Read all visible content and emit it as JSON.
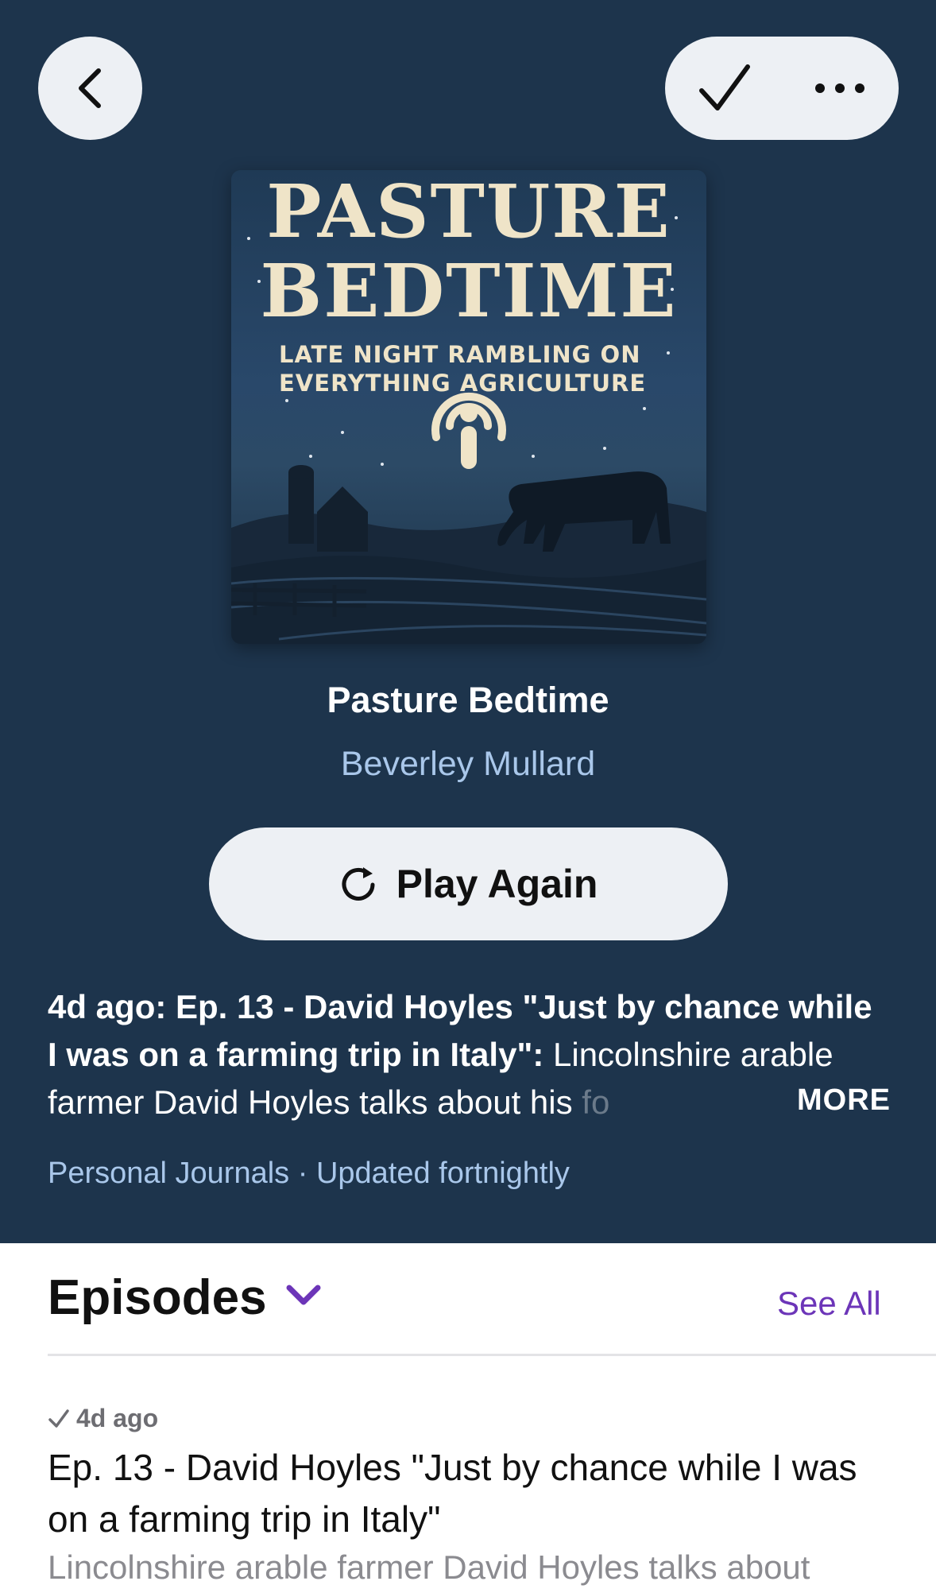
{
  "nav": {
    "back_icon": "chevron-left-icon",
    "check_icon": "checkmark-icon",
    "more_icon": "ellipsis-icon"
  },
  "cover": {
    "title_line1": "PASTURE",
    "title_line2": "BEDTIME",
    "subtitle_line1": "LATE NIGHT RAMBLING ON",
    "subtitle_line2": "EVERYTHING AGRICULTURE",
    "icon": "podcast-icon"
  },
  "show": {
    "title": "Pasture Bedtime",
    "author": "Beverley Mullard"
  },
  "play": {
    "label": "Play Again",
    "icon": "replay-icon"
  },
  "description": {
    "prefix": "4d ago: Ep. 13 - David Hoyles \"Just by chance while I was on a farming trip in Italy\":",
    "body": " Lincolnshire arable farmer David Hoyles talks about his ",
    "faded": "fo",
    "more": "MORE"
  },
  "meta": {
    "category": "Personal Journals",
    "separator": "·",
    "frequency": "Updated fortnightly"
  },
  "episodes": {
    "heading": "Episodes",
    "see_all": "See All",
    "items": [
      {
        "date": "4d ago",
        "title": "Ep. 13 - David Hoyles \"Just by chance while I was on a farming trip in Italy\"",
        "snippet": "Lincolnshire arable farmer David Hoyles talks about"
      }
    ]
  },
  "colors": {
    "hero_bg": "#1d344c",
    "accent_purple": "#6c35b8",
    "secondary_blue": "#a9c7ea"
  }
}
